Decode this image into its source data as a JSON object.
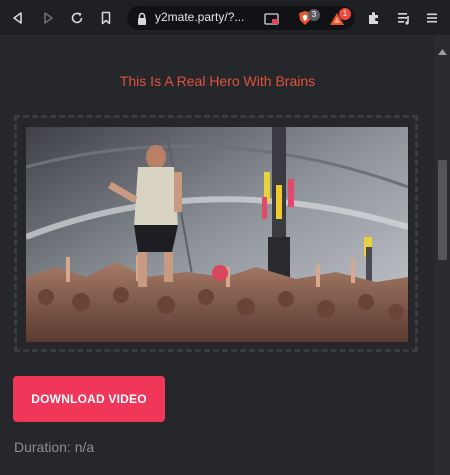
{
  "browser": {
    "url": "y2mate.party/?...",
    "brave_shields_count": "3",
    "brave_rewards_count": "1"
  },
  "main": {
    "title": "This Is A Real Hero With Brains",
    "download_label": "DOWNLOAD VIDEO",
    "duration": "Duration: n/a"
  },
  "colors": {
    "title": "#e3513c",
    "button": "#f0375a",
    "background": "#26272b"
  },
  "icons": {
    "back": "back-icon",
    "forward": "forward-icon",
    "reload": "reload-icon",
    "bookmark": "bookmark-icon",
    "lock": "lock-icon",
    "extensions": "puzzle-icon",
    "playlist": "playlist-icon",
    "menu": "menu-icon"
  }
}
